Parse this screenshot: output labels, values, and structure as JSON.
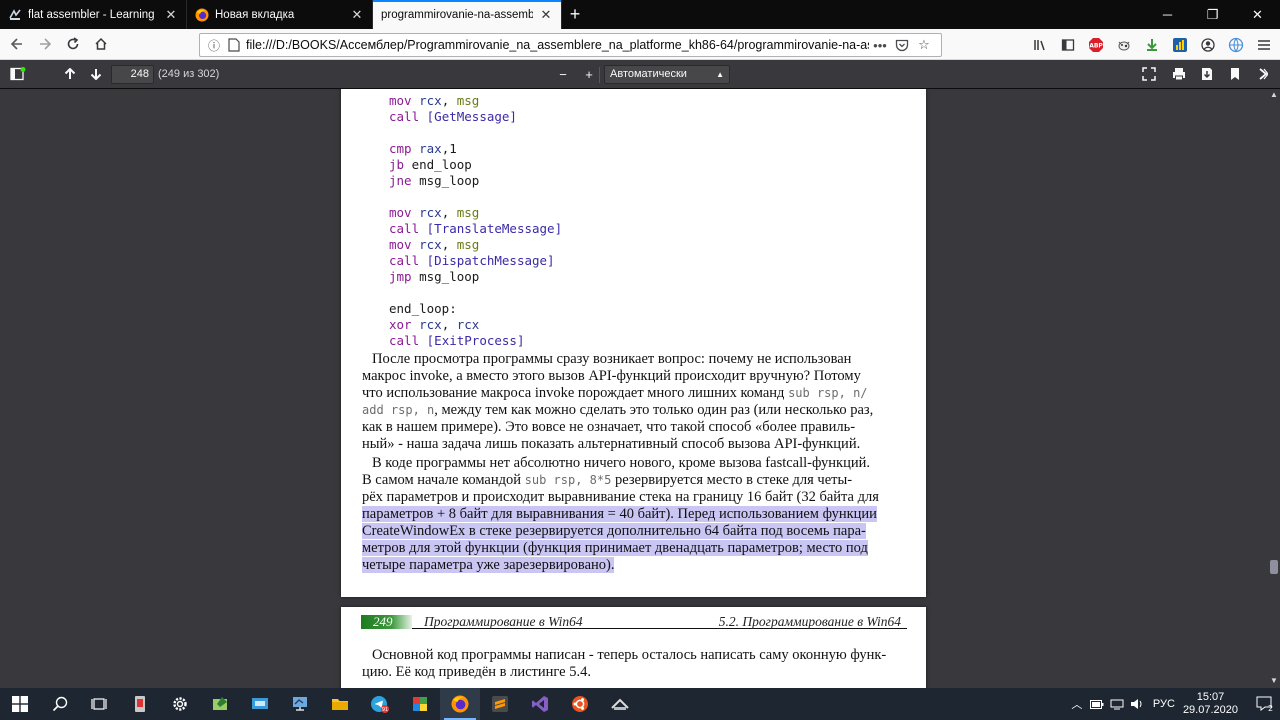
{
  "tabs": [
    {
      "label": "flat assembler - Learning binary",
      "icon": "flat-assembler-icon",
      "active": false
    },
    {
      "label": "Новая вкладка",
      "icon": "firefox-icon",
      "active": false
    },
    {
      "label": "programmirovanie-na-assemblere",
      "icon": "pdf-icon",
      "active": true
    }
  ],
  "address": {
    "url": "file:///D:/BOOKS/Ассемблер/Programmirovanie_na_assemblere_na_platforme_kh86-64/programmirovanie-na-assemblere"
  },
  "pdf_toolbar": {
    "page_number": "248",
    "page_count": "(249 из 302)",
    "zoom_out": "−",
    "zoom_in": "+",
    "zoom_value": "Автоматически"
  },
  "page248": {
    "code": [
      {
        "indent": "",
        "kw": "mov",
        "sp1": " ",
        "reg": "rcx",
        "sep": ", ",
        "arg": "msg",
        "argclass": "var"
      },
      {
        "indent": "",
        "kw": "call",
        "sp1": " ",
        "reg": "",
        "sep": "",
        "arg": "[GetMessage]",
        "argclass": "call"
      },
      {
        "indent": "",
        "kw": "",
        "sp1": "",
        "reg": "",
        "sep": "",
        "arg": "",
        "argclass": ""
      },
      {
        "indent": "",
        "kw": "cmp",
        "sp1": " ",
        "reg": "rax",
        "sep": ",",
        "arg": "1",
        "argclass": "plain"
      },
      {
        "indent": "",
        "kw": "jb",
        "sp1": " ",
        "reg": "",
        "sep": "",
        "arg": "end_loop",
        "argclass": "plain"
      },
      {
        "indent": "",
        "kw": "jne",
        "sp1": " ",
        "reg": "",
        "sep": "",
        "arg": "msg_loop",
        "argclass": "plain"
      },
      {
        "indent": "",
        "kw": "",
        "sp1": "",
        "reg": "",
        "sep": "",
        "arg": "",
        "argclass": ""
      },
      {
        "indent": "",
        "kw": "mov",
        "sp1": " ",
        "reg": "rcx",
        "sep": ", ",
        "arg": "msg",
        "argclass": "var"
      },
      {
        "indent": "",
        "kw": "call",
        "sp1": " ",
        "reg": "",
        "sep": "",
        "arg": "[TranslateMessage]",
        "argclass": "call"
      },
      {
        "indent": "",
        "kw": "mov",
        "sp1": " ",
        "reg": "rcx",
        "sep": ", ",
        "arg": "msg",
        "argclass": "var"
      },
      {
        "indent": "",
        "kw": "call",
        "sp1": " ",
        "reg": "",
        "sep": "",
        "arg": "[DispatchMessage]",
        "argclass": "call"
      },
      {
        "indent": "",
        "kw": "jmp",
        "sp1": " ",
        "reg": "",
        "sep": "",
        "arg": "msg_loop",
        "argclass": "plain"
      },
      {
        "indent": "",
        "kw": "",
        "sp1": "",
        "reg": "",
        "sep": "",
        "arg": "",
        "argclass": ""
      },
      {
        "indent": "",
        "kw": "",
        "sp1": "",
        "reg": "",
        "sep": "",
        "arg": "end_loop:",
        "argclass": "plain"
      },
      {
        "indent": "",
        "kw": "xor",
        "sp1": " ",
        "reg": "rcx",
        "sep": ", ",
        "arg": "rcx",
        "argclass": "reg"
      },
      {
        "indent": "",
        "kw": "call",
        "sp1": " ",
        "reg": "",
        "sep": "",
        "arg": "[ExitProcess]",
        "argclass": "call"
      }
    ],
    "para1": {
      "l1": "После просмотра программы сразу возникает вопрос: почему не использован",
      "l2": "макрос invoke, а вместо этого вызов API-функций происходит вручную? Потому",
      "l3a": "что использование макроса invoke порождает много лишних команд ",
      "l3code": "sub rsp, n/",
      "l4code": "add rsp, n",
      "l4b": ", между тем как можно сделать это только один раз (или несколько раз,",
      "l5": "как в нашем примере). Это вовсе не означает, что такой способ «более правиль-",
      "l6": "ный» - наша задача лишь показать альтернативный способ вызова API-функций."
    },
    "para2": {
      "l1": "В коде программы нет абсолютно ничего нового, кроме вызова fastcall-функций.",
      "l2a": "В самом начале командой ",
      "l2code": "sub rsp, 8*5",
      "l2b": " резервируется место в стеке для четы-",
      "l3": "рёх параметров и происходит выравнивание стека на границу 16 байт (32 байта для",
      "l4": "параметров + 8 байт для выравнивания = 40 байт). Перед использованием функции",
      "l5": "CreateWindowEx в стеке резервируется дополнительно 64 байта под восемь пара-",
      "l6": "метров для этой функции (функция принимает двенадцать параметров; место под",
      "l7": "четыре параметра уже зарезервировано)."
    }
  },
  "page249": {
    "page_num": "249",
    "head_left": "Программирование в Win64",
    "head_right": "5.2. Программирование в Win64",
    "l1": "Основной код программы написан - теперь осталось написать саму оконную функ-",
    "l2": "цию. Её код приведён в листинге 5.4."
  },
  "taskbar": {
    "lang": "РУС",
    "time": "15:07",
    "date": "29.07.2020",
    "notifications": "2"
  },
  "colors": {
    "accent": "#0a84ff",
    "highlight": "#c9c6f4",
    "keyword": "#8a1b93",
    "register": "#2c3a8f"
  }
}
